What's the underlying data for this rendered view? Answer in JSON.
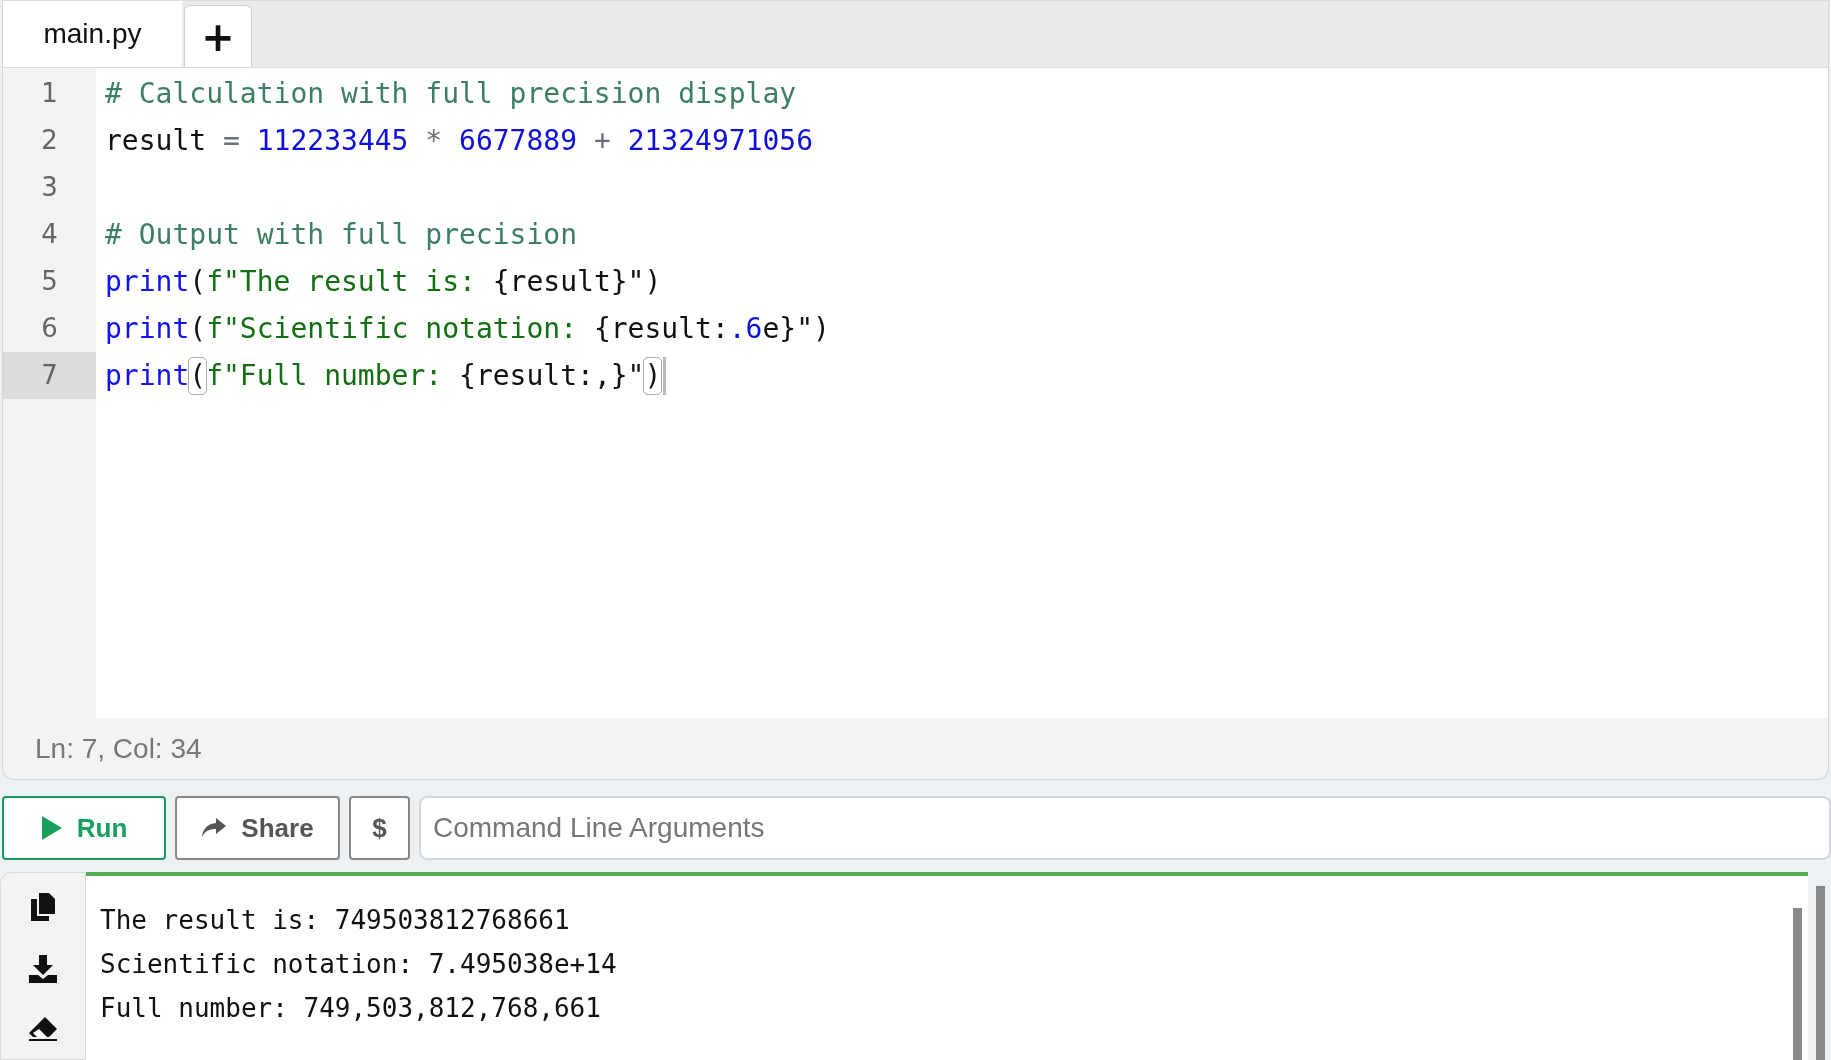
{
  "tabs": [
    {
      "label": "main.py",
      "selected": true
    }
  ],
  "add_tab_button": "+",
  "editor": {
    "lines": [
      {
        "number": "1",
        "active": false,
        "tokens": [
          {
            "kind": "comment",
            "text": "# Calculation with full precision display"
          }
        ]
      },
      {
        "number": "2",
        "active": false,
        "tokens": [
          {
            "kind": "plain",
            "text": "result"
          },
          {
            "kind": "operator",
            "text": " = "
          },
          {
            "kind": "number",
            "text": "112233445"
          },
          {
            "kind": "operator",
            "text": " * "
          },
          {
            "kind": "number",
            "text": "6677889"
          },
          {
            "kind": "operator",
            "text": " + "
          },
          {
            "kind": "number",
            "text": "21324971056"
          }
        ]
      },
      {
        "number": "3",
        "active": false
      },
      {
        "number": "4",
        "active": false,
        "tokens": [
          {
            "kind": "comment",
            "text": "# Output with full precision"
          }
        ]
      },
      {
        "number": "5",
        "active": false,
        "tokens": [
          {
            "kind": "keyword",
            "text": "print"
          },
          {
            "kind": "plain",
            "text": "("
          },
          {
            "kind": "string",
            "text": "f\"The result is: "
          },
          {
            "kind": "plain",
            "text": "{result}\")"
          }
        ]
      },
      {
        "number": "6",
        "active": false,
        "tokens": [
          {
            "kind": "keyword",
            "text": "print"
          },
          {
            "kind": "plain",
            "text": "("
          },
          {
            "kind": "string",
            "text": "f\"Scientific notation: "
          },
          {
            "kind": "plain",
            "text": "{result:"
          },
          {
            "kind": "number",
            "text": ".6"
          },
          {
            "kind": "plain",
            "text": "e}\")"
          }
        ]
      },
      {
        "number": "7",
        "active": true,
        "tokens": [
          {
            "kind": "keyword",
            "text": "print"
          },
          {
            "kind": "matched",
            "text": "("
          },
          {
            "kind": "string",
            "text": "f\"Full number: "
          },
          {
            "kind": "plain",
            "text": "{result:,}\""
          },
          {
            "kind": "matched",
            "text": ")"
          }
        ]
      }
    ],
    "status": "Ln: 7,  Col: 34"
  },
  "toolbar": {
    "run_button": "Run",
    "share_button": "Share",
    "dollar_button": "$",
    "arguments_field": {
      "placeholder": "Command Line Arguments"
    }
  },
  "output": {
    "lines": [
      "The result is: 749503812768661",
      "Scientific notation: 7.495038e+14",
      "Full number: 749,503,812,768,661"
    ]
  }
}
